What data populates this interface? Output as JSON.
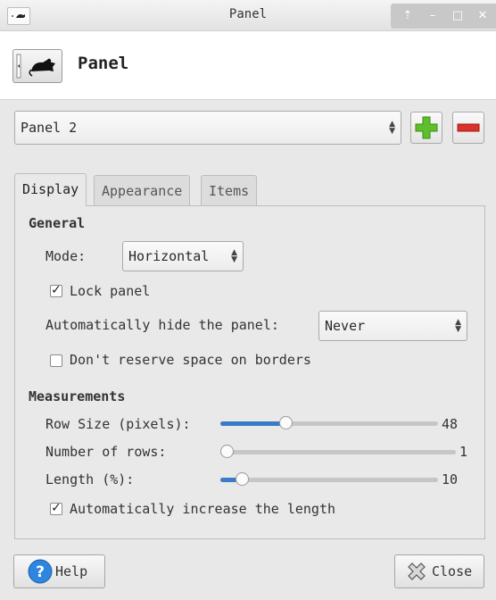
{
  "window": {
    "title": "Panel",
    "buttons": {
      "up": "⇡",
      "minimize": "–",
      "maximize": "□",
      "close": "✕"
    }
  },
  "header": {
    "title": "Panel",
    "icon": "panel-mouse-icon"
  },
  "panel_selector": {
    "value": "Panel 2",
    "add_icon": "plus-icon",
    "remove_icon": "minus-icon"
  },
  "tabs": [
    {
      "label": "Display",
      "active": true
    },
    {
      "label": "Appearance",
      "active": false
    },
    {
      "label": "Items",
      "active": false
    }
  ],
  "general": {
    "heading": "General",
    "mode_label": "Mode:",
    "mode_value": "Horizontal",
    "lock_panel_label": "Lock panel",
    "lock_panel_checked": true,
    "autohide_label": "Automatically hide the panel:",
    "autohide_value": "Never",
    "reserve_label": "Don't reserve space on borders",
    "reserve_checked": false
  },
  "measurements": {
    "heading": "Measurements",
    "row_size": {
      "label": "Row Size (pixels):",
      "value": "48",
      "fraction": 0.3
    },
    "rows": {
      "label": "Number of rows:",
      "value": "1",
      "fraction": 0.0
    },
    "length": {
      "label": "Length (%):",
      "value": "10",
      "fraction": 0.1
    },
    "auto_length_label": "Automatically increase the length",
    "auto_length_checked": true
  },
  "footer": {
    "help_label": "Help",
    "close_label": "Close"
  },
  "colors": {
    "accent": "#3a7bc8",
    "add": "#5fbf2a",
    "remove": "#d9332b",
    "help": "#2e86de"
  }
}
